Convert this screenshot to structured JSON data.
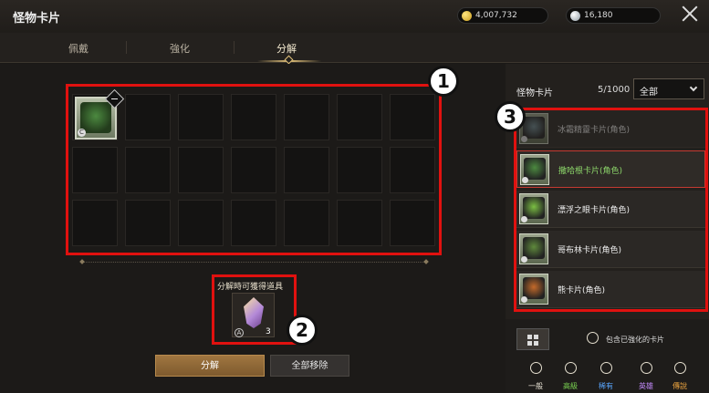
{
  "header": {
    "title": "怪物卡片",
    "gold": "4,007,732",
    "crystal": "16,180"
  },
  "tabs": [
    "佩戴",
    "強化",
    "分解"
  ],
  "active_tab": "分解",
  "grid": {
    "rows": 3,
    "cols": 7,
    "occupied_slot_grade": "C"
  },
  "callouts": [
    "1",
    "2",
    "3"
  ],
  "reward": {
    "label": "分解時可獲得道具",
    "grade": "A",
    "count": "3"
  },
  "buttons": {
    "decompose": "分解",
    "remove_all": "全部移除"
  },
  "card_panel": {
    "title": "怪物卡片",
    "count": "5/1000",
    "filter": "全部",
    "items": [
      {
        "name": "冰霜精靈卡片(角色)",
        "state": "dim",
        "art_color": "#6f8c95"
      },
      {
        "name": "撒哈根卡片(角色)",
        "state": "selected",
        "art_color": "#4c8a40"
      },
      {
        "name": "漂浮之眼卡片(角色)",
        "state": "normal",
        "art_color": "#7bbf43"
      },
      {
        "name": "哥布林卡片(角色)",
        "state": "normal",
        "art_color": "#5f8a3c"
      },
      {
        "name": "熊卡片(角色)",
        "state": "normal",
        "art_color": "#c46a2a"
      }
    ],
    "include_enhanced_label": "包含已強化的卡片",
    "grade_filters": [
      {
        "label": "一般",
        "color": "#e8e2d4"
      },
      {
        "label": "高級",
        "color": "#78d050"
      },
      {
        "label": "稀有",
        "color": "#59a6ff"
      },
      {
        "label": "英雄",
        "color": "#c58cff"
      },
      {
        "label": "傳說",
        "color": "#f0a640"
      }
    ]
  }
}
